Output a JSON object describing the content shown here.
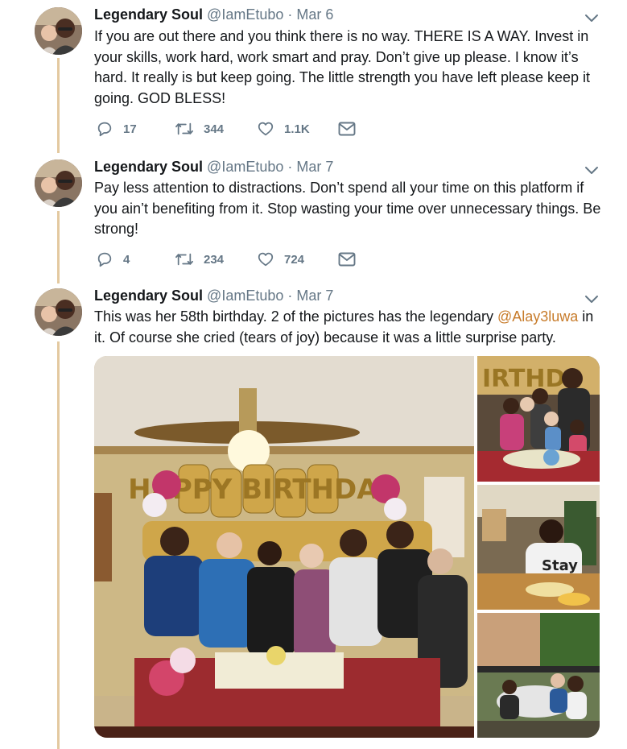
{
  "tweets": [
    {
      "name": "Legendary Soul",
      "handle": "@IamEtubo",
      "separator": "·",
      "date": "Mar 6",
      "text": "If you are out there and you think there is no way. THERE IS A WAY. Invest in your skills, work hard, work smart and pray. Don’t give up please. I know it’s hard. It really is but keep going. The little strength you have left please keep it going. GOD BLESS!",
      "replies": "17",
      "retweets": "344",
      "likes": "1.1K"
    },
    {
      "name": "Legendary Soul",
      "handle": "@IamEtubo",
      "separator": "·",
      "date": "Mar 7",
      "text": "Pay less attention to distractions. Don’t spend all your time on this platform if you ain’t benefiting from it. Stop wasting your time over unnecessary things. Be strong!",
      "replies": "4",
      "retweets": "234",
      "likes": "724"
    },
    {
      "name": "Legendary Soul",
      "handle": "@IamEtubo",
      "separator": "·",
      "date": "Mar 7",
      "text_before": "This was her 58th birthday. 2 of the pictures has the legendary ",
      "mention": "@Alay3luwa",
      "text_after": " in it. Of course she cried (tears of joy) because it was a little surprise party.",
      "media": {
        "balloon_text": "HAPPY BIRTHDAY",
        "side_balloon_text": "IRTHD",
        "shirt_text": "Stay"
      }
    }
  ],
  "colors": {
    "text": "#14171a",
    "muted": "#657786",
    "mention": "#c77b2a",
    "thread_line": "#e3c9a0"
  },
  "icons": [
    "reply-icon",
    "retweet-icon",
    "like-icon",
    "message-icon",
    "chevron-down-icon"
  ]
}
